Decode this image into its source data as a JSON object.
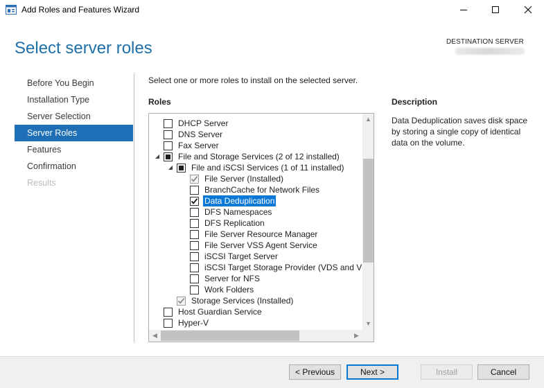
{
  "window": {
    "title": "Add Roles and Features Wizard",
    "minimize_icon": "minimize-icon",
    "maximize_icon": "maximize-icon",
    "close_icon": "close-icon"
  },
  "header": {
    "page_title": "Select server roles",
    "destination_label": "DESTINATION SERVER"
  },
  "nav": {
    "items": [
      {
        "label": "Before You Begin",
        "state": "normal"
      },
      {
        "label": "Installation Type",
        "state": "normal"
      },
      {
        "label": "Server Selection",
        "state": "normal"
      },
      {
        "label": "Server Roles",
        "state": "active"
      },
      {
        "label": "Features",
        "state": "normal"
      },
      {
        "label": "Confirmation",
        "state": "normal"
      },
      {
        "label": "Results",
        "state": "disabled"
      }
    ]
  },
  "main": {
    "instruction": "Select one or more roles to install on the selected server.",
    "roles_heading": "Roles",
    "roles": [
      {
        "label": "DHCP Server",
        "level": 0,
        "state": "unchecked",
        "expander": "none"
      },
      {
        "label": "DNS Server",
        "level": 0,
        "state": "unchecked",
        "expander": "none"
      },
      {
        "label": "Fax Server",
        "level": 0,
        "state": "unchecked",
        "expander": "none"
      },
      {
        "label": "File and Storage Services (2 of 12 installed)",
        "level": 0,
        "state": "partial",
        "expander": "expanded"
      },
      {
        "label": "File and iSCSI Services (1 of 11 installed)",
        "level": 1,
        "state": "partial",
        "expander": "expanded"
      },
      {
        "label": "File Server (Installed)",
        "level": 2,
        "state": "checked-grey",
        "expander": "none"
      },
      {
        "label": "BranchCache for Network Files",
        "level": 2,
        "state": "unchecked",
        "expander": "none"
      },
      {
        "label": "Data Deduplication",
        "level": 2,
        "state": "checked",
        "expander": "none",
        "selected": true
      },
      {
        "label": "DFS Namespaces",
        "level": 2,
        "state": "unchecked",
        "expander": "none"
      },
      {
        "label": "DFS Replication",
        "level": 2,
        "state": "unchecked",
        "expander": "none"
      },
      {
        "label": "File Server Resource Manager",
        "level": 2,
        "state": "unchecked",
        "expander": "none"
      },
      {
        "label": "File Server VSS Agent Service",
        "level": 2,
        "state": "unchecked",
        "expander": "none"
      },
      {
        "label": "iSCSI Target Server",
        "level": 2,
        "state": "unchecked",
        "expander": "none"
      },
      {
        "label": "iSCSI Target Storage Provider (VDS and VSS",
        "level": 2,
        "state": "unchecked",
        "expander": "none"
      },
      {
        "label": "Server for NFS",
        "level": 2,
        "state": "unchecked",
        "expander": "none"
      },
      {
        "label": "Work Folders",
        "level": 2,
        "state": "unchecked",
        "expander": "none"
      },
      {
        "label": "Storage Services (Installed)",
        "level": 1,
        "state": "checked-grey",
        "expander": "none"
      },
      {
        "label": "Host Guardian Service",
        "level": 0,
        "state": "unchecked",
        "expander": "none"
      },
      {
        "label": "Hyper-V",
        "level": 0,
        "state": "unchecked",
        "expander": "none"
      }
    ],
    "description_heading": "Description",
    "description_text": "Data Deduplication saves disk space by storing a single copy of identical data on the volume."
  },
  "footer": {
    "previous_label": "< Previous",
    "next_label": "Next >",
    "install_label": "Install",
    "cancel_label": "Cancel"
  },
  "colors": {
    "accent": "#1e6fb6",
    "title_blue": "#1e6fa8",
    "selection": "#0a78d7"
  }
}
